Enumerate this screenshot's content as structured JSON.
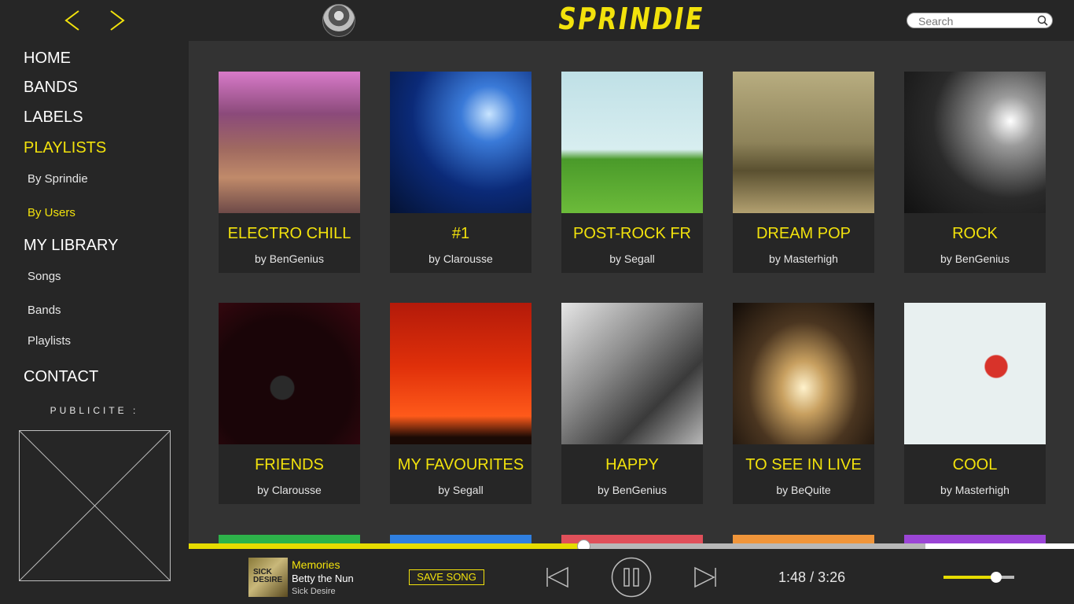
{
  "header": {
    "logo": "SPRINDIE",
    "search_placeholder": "Search"
  },
  "sidebar": {
    "menu": [
      {
        "label": "HOME",
        "active": false
      },
      {
        "label": "BANDS",
        "active": false
      },
      {
        "label": "LABELS",
        "active": false
      },
      {
        "label": "PLAYLISTS",
        "active": true
      },
      {
        "label": "By Sprindie",
        "active": false
      },
      {
        "label": "By Users",
        "active": true
      },
      {
        "label": "MY LIBRARY",
        "active": false
      },
      {
        "label": "Songs",
        "active": false
      },
      {
        "label": "Bands",
        "active": false
      },
      {
        "label": "Playlists",
        "active": false
      },
      {
        "label": "CONTACT",
        "active": false
      }
    ],
    "ad_label": "PUBLICITE :"
  },
  "playlists": [
    {
      "title": "ELECTRO CHILL",
      "author": "by BenGenius"
    },
    {
      "title": "#1",
      "author": "by Clarousse"
    },
    {
      "title": "POST-ROCK FR",
      "author": "by Segall"
    },
    {
      "title": "DREAM POP",
      "author": "by Masterhigh"
    },
    {
      "title": "ROCK",
      "author": "by BenGenius"
    },
    {
      "title": "FRIENDS",
      "author": "by Clarousse"
    },
    {
      "title": "MY FAVOURITES",
      "author": "by Segall"
    },
    {
      "title": "HAPPY",
      "author": "by BenGenius"
    },
    {
      "title": "TO SEE IN LIVE",
      "author": "by BeQuite"
    },
    {
      "title": "COOL",
      "author": "by Masterhigh"
    }
  ],
  "next_row_colors": [
    "#2db34a",
    "#2f7fe0",
    "#e0505a",
    "#f0953a",
    "#9b45d6"
  ],
  "player": {
    "song_title": "Memories",
    "artist": "Betty the Nun",
    "album": "Sick Desire",
    "cover_text": "SICK DESIRE",
    "save_label": "SAVE SONG",
    "elapsed": "1:48",
    "separator": "/",
    "duration": "3:26",
    "progress": 0.446,
    "buffered": 0.832,
    "volume": 0.74
  },
  "colors": {
    "accent": "#f2e20c",
    "panel": "#262626",
    "background": "#333333"
  }
}
